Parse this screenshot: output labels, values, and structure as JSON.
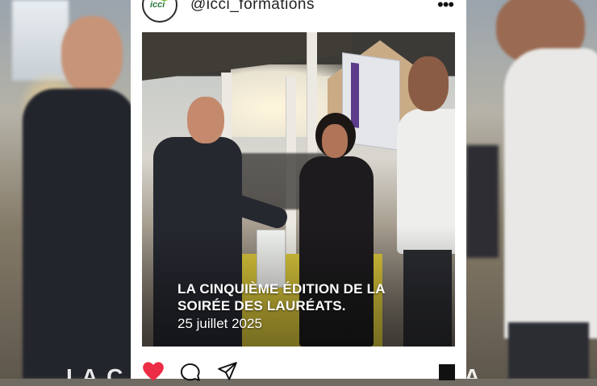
{
  "profile": {
    "username": "@icci_formations",
    "avatar_logo_text": "icci"
  },
  "header": {
    "more_icon": "more-horizontal-icon"
  },
  "post": {
    "caption_line1": "LA CINQUIÈME ÉDITION DE LA",
    "caption_line2": "SOIRÉE DES LAURÉATS.",
    "date": "25 juillet 2025"
  },
  "actions": {
    "like_icon": "heart-icon",
    "comment_icon": "comment-icon",
    "share_icon": "send-icon",
    "save_icon": "bookmark-icon",
    "like_color": "#ed2c45"
  },
  "backdrop": {
    "caption_fragment_left": "LA C",
    "caption_fragment_right": "A"
  }
}
